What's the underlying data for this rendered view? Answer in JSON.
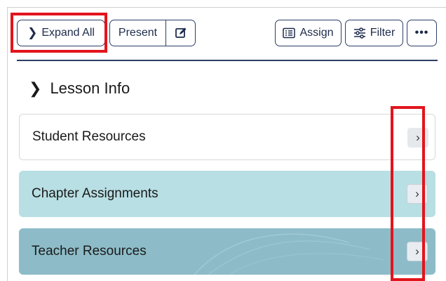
{
  "toolbar": {
    "expand_all_label": "Expand All",
    "present_label": "Present",
    "assign_label": "Assign",
    "filter_label": "Filter",
    "more_label": "•••"
  },
  "section": {
    "title": "Lesson Info"
  },
  "cards": [
    {
      "label": "Student Resources",
      "color": "#ffffff"
    },
    {
      "label": "Chapter Assignments",
      "color": "#b8dfe3"
    },
    {
      "label": "Teacher Resources",
      "color": "#8dbcc8"
    }
  ],
  "icons": {
    "expand": "chevron-right-icon",
    "edit": "edit-icon",
    "assign": "assign-icon",
    "filter": "filter-icon",
    "card_open": "chevron-right-icon"
  },
  "colors": {
    "accent": "#2b3f66",
    "highlight": "#e3141c"
  }
}
